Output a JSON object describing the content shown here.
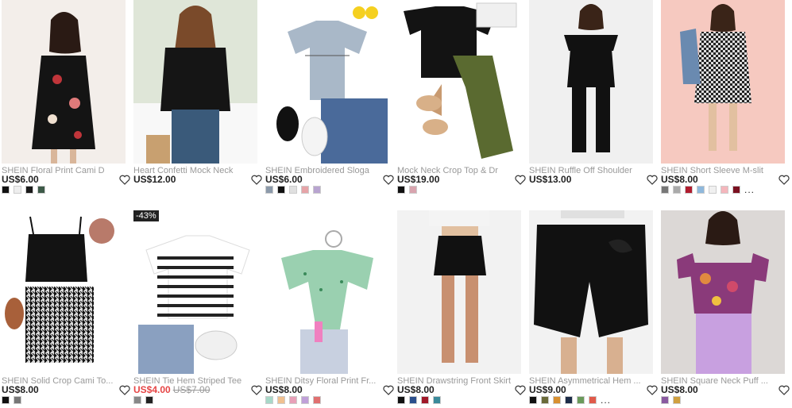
{
  "products": [
    {
      "title": "SHEIN Floral Print Cami D",
      "price": "US$6.00",
      "swatches": [
        "#111111",
        "#eeeeee",
        "#1a1a1a",
        "#3d5a48"
      ],
      "more": false
    },
    {
      "title": "Heart Confetti Mock Neck",
      "price": "US$12.00",
      "swatches": [],
      "more": false
    },
    {
      "title": "SHEIN Embroidered Sloga",
      "price": "US$6.00",
      "swatches": [
        "#8c9aaa",
        "#111111",
        "#e0e0e0",
        "#e6a4a8",
        "#b8a4d0"
      ],
      "more": false
    },
    {
      "title": "Mock Neck Crop Top & Dr",
      "price": "US$19.00",
      "swatches": [
        "#111111",
        "#d8a4ae"
      ],
      "more": false
    },
    {
      "title": "SHEIN Ruffle Off Shoulder",
      "price": "US$13.00",
      "swatches": [],
      "more": false
    },
    {
      "title": "SHEIN Short Sleeve M-slit",
      "price": "US$8.00",
      "swatches": [
        "#777777",
        "#aaaaaa",
        "#b01c2e",
        "#8fb8dc",
        "#f0f0f0",
        "#f4b6bc",
        "#7a1020"
      ],
      "more": true
    },
    {
      "title": "SHEIN Solid Crop Cami To...",
      "price": "US$8.00",
      "swatches": [
        "#111111",
        "#777777"
      ],
      "more": false
    },
    {
      "title": "SHEIN Tie Hem Striped Tee",
      "price": "",
      "sale": "US$4.00",
      "orig": "US$7.00",
      "badge": "-43%",
      "swatches": [
        "#888888",
        "#222222"
      ],
      "more": false
    },
    {
      "title": "SHEIN Ditsy Floral Print Fr...",
      "price": "US$8.00",
      "swatches": [
        "#a8d8c8",
        "#f0c090",
        "#e8a0b8",
        "#c0a0d8",
        "#e07070"
      ],
      "more": false
    },
    {
      "title": "SHEIN Drawstring Front Skirt",
      "price": "US$8.00",
      "swatches": [
        "#111111",
        "#2b4f8c",
        "#a01828",
        "#3a8a9a"
      ],
      "more": false
    },
    {
      "title": "SHEIN Asymmetrical Hem ...",
      "price": "US$9.00",
      "swatches": [
        "#111111",
        "#6a6a3a",
        "#d89030",
        "#1c2c48",
        "#6a9a5a",
        "#e05a4a"
      ],
      "more": true
    },
    {
      "title": "SHEIN Square Neck Puff ...",
      "price": "US$8.00",
      "swatches": [
        "#8a5aa0",
        "#d0a040"
      ],
      "more": false
    }
  ],
  "more_label": "..."
}
